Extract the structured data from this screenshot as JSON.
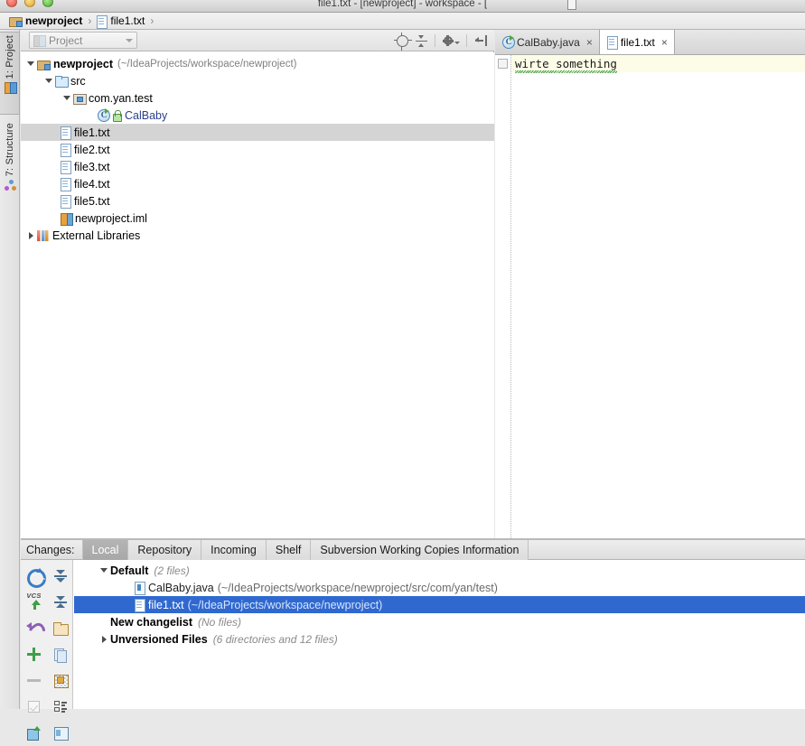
{
  "window": {
    "title": "file1.txt - [newproject] - workspace - [",
    "controls": {
      "close": "close",
      "minimize": "minimize",
      "maximize": "maximize"
    }
  },
  "breadcrumb": {
    "items": [
      {
        "label": "newproject",
        "icon": "module-icon",
        "bold": true
      },
      {
        "label": "file1.txt",
        "icon": "text-file-icon",
        "bold": false
      }
    ],
    "separator": "›"
  },
  "left_tool_tabs": [
    {
      "label": "1: Project",
      "icon": "project-icon",
      "active": true
    },
    {
      "label": "7: Structure",
      "icon": "structure-icon",
      "active": false
    }
  ],
  "project_panel": {
    "combo_value": "Project",
    "toolbar": [
      {
        "name": "locate-icon",
        "tooltip": "Scroll from Source"
      },
      {
        "name": "collapse-all-icon",
        "tooltip": "Collapse All"
      },
      {
        "name": "gear-icon",
        "tooltip": "Settings"
      },
      {
        "name": "hide-icon",
        "tooltip": "Hide"
      }
    ],
    "tree": [
      {
        "depth": 0,
        "twisty": "down",
        "icon": "module-icon",
        "label": "newproject",
        "bold": true,
        "path": "(~/IdeaProjects/workspace/newproject)",
        "selected": false,
        "link": false
      },
      {
        "depth": 1,
        "twisty": "down",
        "icon": "folder-icon",
        "label": "src",
        "bold": false,
        "path": "",
        "selected": false,
        "link": false
      },
      {
        "depth": 2,
        "twisty": "down",
        "icon": "package-icon",
        "label": "com.yan.test",
        "bold": false,
        "path": "",
        "selected": false,
        "link": false
      },
      {
        "depth": 3,
        "twisty": "none",
        "icon": "class-icon",
        "label": "CalBaby",
        "bold": false,
        "path": "",
        "selected": false,
        "link": true,
        "badge": "lock-icon"
      },
      {
        "depth": 2,
        "twisty": "none",
        "icon": "text-file-icon",
        "label": "file1.txt",
        "bold": false,
        "path": "",
        "selected": true,
        "link": false
      },
      {
        "depth": 2,
        "twisty": "none",
        "icon": "text-file-icon",
        "label": "file2.txt",
        "bold": false,
        "path": "",
        "selected": false,
        "link": false
      },
      {
        "depth": 2,
        "twisty": "none",
        "icon": "text-file-icon",
        "label": "file3.txt",
        "bold": false,
        "path": "",
        "selected": false,
        "link": false
      },
      {
        "depth": 2,
        "twisty": "none",
        "icon": "text-file-icon",
        "label": "file4.txt",
        "bold": false,
        "path": "",
        "selected": false,
        "link": false
      },
      {
        "depth": 2,
        "twisty": "none",
        "icon": "text-file-icon",
        "label": "file5.txt",
        "bold": false,
        "path": "",
        "selected": false,
        "link": false
      },
      {
        "depth": 2,
        "twisty": "none",
        "icon": "iml-icon",
        "label": "newproject.iml",
        "bold": false,
        "path": "",
        "selected": false,
        "link": false
      },
      {
        "depth": 0,
        "twisty": "right",
        "icon": "library-icon",
        "label": "External Libraries",
        "bold": false,
        "path": "",
        "selected": false,
        "link": false
      }
    ]
  },
  "editor": {
    "tabs": [
      {
        "label": "CalBaby.java",
        "icon": "java-class-icon",
        "active": false,
        "close": "×"
      },
      {
        "label": "file1.txt",
        "icon": "text-file-icon",
        "active": true,
        "close": "×"
      }
    ],
    "lines": [
      {
        "text": "wirte something",
        "misspelled": true
      }
    ]
  },
  "changes_panel": {
    "label": "Changes:",
    "tabs": [
      {
        "label": "Local",
        "active": true
      },
      {
        "label": "Repository",
        "active": false
      },
      {
        "label": "Incoming",
        "active": false
      },
      {
        "label": "Shelf",
        "active": false
      },
      {
        "label": "Subversion Working Copies Information",
        "active": false
      }
    ],
    "toolbar": [
      {
        "name": "refresh-icon"
      },
      {
        "name": "expand-all-icon"
      },
      {
        "name": "vcs-update-icon"
      },
      {
        "name": "collapse-all-icon"
      },
      {
        "name": "rollback-icon"
      },
      {
        "name": "new-changelist-icon"
      },
      {
        "name": "add-icon"
      },
      {
        "name": "move-to-changelist-icon"
      },
      {
        "name": "remove-icon"
      },
      {
        "name": "show-diff-icon"
      },
      {
        "name": "checkbox-icon"
      },
      {
        "name": "group-by-icon"
      },
      {
        "name": "shelve-icon"
      },
      {
        "name": "preferences-icon"
      }
    ],
    "tree": [
      {
        "depth": 0,
        "twisty": "down",
        "icon": "none",
        "label": "Default",
        "bold": true,
        "meta": "(2 files)",
        "selected": false
      },
      {
        "depth": 1,
        "twisty": "none",
        "icon": "java-file-icon",
        "label": "CalBaby.java",
        "bold": false,
        "meta": "",
        "path": "(~/IdeaProjects/workspace/newproject/src/com/yan/test)",
        "selected": false
      },
      {
        "depth": 1,
        "twisty": "none",
        "icon": "text-file-icon",
        "label": "file1.txt",
        "bold": false,
        "meta": "",
        "path": "(~/IdeaProjects/workspace/newproject)",
        "selected": true
      },
      {
        "depth": 0,
        "twisty": "none",
        "icon": "none",
        "label": "New changelist",
        "bold": true,
        "meta": "(No files)",
        "selected": false
      },
      {
        "depth": 0,
        "twisty": "right",
        "icon": "none",
        "label": "Unversioned Files",
        "bold": true,
        "meta": "(6 directories and 12 files)",
        "selected": false
      }
    ]
  },
  "colors": {
    "selection_active": "#2f69d0",
    "selection_inactive": "#d4d4d4",
    "current_line": "#fdfde7",
    "link_text": "#2b3f8c",
    "typo_underline": "#3c9a3c",
    "tab_active_bg": "#ffffff",
    "changes_tab_active_bg": "#aeaeae"
  }
}
